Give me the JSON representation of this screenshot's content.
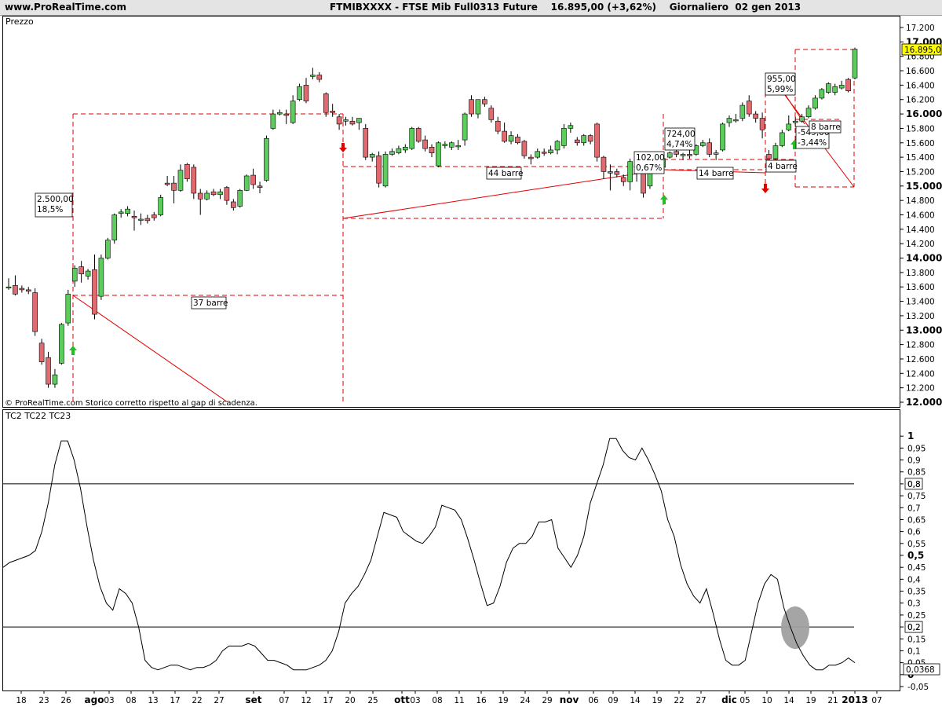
{
  "header": {
    "site": "www.ProRealTime.com",
    "title": "FTMIBXXXX - FTSE Mib Full0313 Future    16.895,00 (+3,62%)    Giornaliero  02 gen 2013"
  },
  "chart_data": [
    {
      "type": "candlestick",
      "title": "Prezzo",
      "footnote": "© ProRealTime.com  Storico corretto rispetto al gap di scadenza.",
      "ylim": [
        12000,
        17200
      ],
      "y_ticks": [
        "17.200",
        "17.000",
        "16.800",
        "16.600",
        "16.400",
        "16.200",
        "16.000",
        "15.800",
        "15.600",
        "15.400",
        "15.200",
        "15.000",
        "14.800",
        "14.600",
        "14.400",
        "14.200",
        "14.000",
        "13.800",
        "13.600",
        "13.400",
        "13.200",
        "13.000",
        "12.800",
        "12.600",
        "12.400",
        "12.200",
        "12.000"
      ],
      "last_price_label": "16.895,0",
      "last_price": 16895,
      "colors": {
        "up": "#5ccd5c",
        "down": "#e06a70",
        "annotation": "#e00000",
        "last_price_bg": "#ffff00"
      },
      "candles": [
        {
          "o": 13600,
          "h": 13720,
          "l": 13560,
          "c": 13600
        },
        {
          "o": 13620,
          "h": 13760,
          "l": 13480,
          "c": 13500
        },
        {
          "o": 13580,
          "h": 13620,
          "l": 13520,
          "c": 13560
        },
        {
          "o": 13560,
          "h": 13600,
          "l": 13500,
          "c": 13540
        },
        {
          "o": 13520,
          "h": 13580,
          "l": 12920,
          "c": 12980
        },
        {
          "o": 12820,
          "h": 12880,
          "l": 12520,
          "c": 12560
        },
        {
          "o": 12620,
          "h": 12700,
          "l": 12200,
          "c": 12250
        },
        {
          "o": 12250,
          "h": 12460,
          "l": 12200,
          "c": 12380
        },
        {
          "o": 12540,
          "h": 13100,
          "l": 12520,
          "c": 13080
        },
        {
          "o": 13100,
          "h": 13560,
          "l": 13060,
          "c": 13500
        },
        {
          "o": 13680,
          "h": 13900,
          "l": 13600,
          "c": 13860
        },
        {
          "o": 13880,
          "h": 13960,
          "l": 13660,
          "c": 13780
        },
        {
          "o": 13750,
          "h": 13850,
          "l": 13700,
          "c": 13820
        },
        {
          "o": 13840,
          "h": 14050,
          "l": 13150,
          "c": 13220
        },
        {
          "o": 13470,
          "h": 14050,
          "l": 13420,
          "c": 14000
        },
        {
          "o": 14000,
          "h": 14280,
          "l": 13980,
          "c": 14250
        },
        {
          "o": 14250,
          "h": 14620,
          "l": 14200,
          "c": 14600
        },
        {
          "o": 14620,
          "h": 14680,
          "l": 14560,
          "c": 14640
        },
        {
          "o": 14620,
          "h": 14720,
          "l": 14580,
          "c": 14680
        },
        {
          "o": 14580,
          "h": 14660,
          "l": 14380,
          "c": 14560
        },
        {
          "o": 14540,
          "h": 14620,
          "l": 14460,
          "c": 14540
        },
        {
          "o": 14550,
          "h": 14600,
          "l": 14480,
          "c": 14520
        },
        {
          "o": 14600,
          "h": 14640,
          "l": 14520,
          "c": 14560
        },
        {
          "o": 14600,
          "h": 14880,
          "l": 14580,
          "c": 14840
        },
        {
          "o": 15040,
          "h": 15140,
          "l": 15000,
          "c": 15020
        },
        {
          "o": 15040,
          "h": 15140,
          "l": 14760,
          "c": 14940
        },
        {
          "o": 14940,
          "h": 15300,
          "l": 14920,
          "c": 15220
        },
        {
          "o": 15300,
          "h": 15320,
          "l": 15060,
          "c": 15100
        },
        {
          "o": 15260,
          "h": 15300,
          "l": 14820,
          "c": 14900
        },
        {
          "o": 14900,
          "h": 14960,
          "l": 14600,
          "c": 14820
        },
        {
          "o": 14820,
          "h": 14940,
          "l": 14800,
          "c": 14900
        },
        {
          "o": 14920,
          "h": 14960,
          "l": 14860,
          "c": 14880
        },
        {
          "o": 14880,
          "h": 14960,
          "l": 14820,
          "c": 14920
        },
        {
          "o": 14980,
          "h": 15000,
          "l": 14740,
          "c": 14800
        },
        {
          "o": 14780,
          "h": 14820,
          "l": 14660,
          "c": 14700
        },
        {
          "o": 14720,
          "h": 14960,
          "l": 14700,
          "c": 14940
        },
        {
          "o": 14940,
          "h": 15160,
          "l": 14930,
          "c": 15140
        },
        {
          "o": 15150,
          "h": 15240,
          "l": 14960,
          "c": 15020
        },
        {
          "o": 15000,
          "h": 15060,
          "l": 14900,
          "c": 14980
        },
        {
          "o": 15080,
          "h": 15700,
          "l": 15060,
          "c": 15660
        },
        {
          "o": 15800,
          "h": 16060,
          "l": 15780,
          "c": 16000
        },
        {
          "o": 16000,
          "h": 16060,
          "l": 15980,
          "c": 16020
        },
        {
          "o": 16000,
          "h": 16060,
          "l": 15860,
          "c": 15980
        },
        {
          "o": 15880,
          "h": 16260,
          "l": 15860,
          "c": 16180
        },
        {
          "o": 16200,
          "h": 16420,
          "l": 16180,
          "c": 16380
        },
        {
          "o": 16400,
          "h": 16500,
          "l": 16150,
          "c": 16180
        },
        {
          "o": 16520,
          "h": 16640,
          "l": 16480,
          "c": 16540
        },
        {
          "o": 16540,
          "h": 16580,
          "l": 16440,
          "c": 16480
        },
        {
          "o": 16280,
          "h": 16300,
          "l": 15960,
          "c": 16020
        },
        {
          "o": 16040,
          "h": 16140,
          "l": 15960,
          "c": 16020
        },
        {
          "o": 15960,
          "h": 16000,
          "l": 15780,
          "c": 15860
        },
        {
          "o": 15900,
          "h": 15960,
          "l": 15840,
          "c": 15920
        },
        {
          "o": 15900,
          "h": 15960,
          "l": 15840,
          "c": 15860
        },
        {
          "o": 15880,
          "h": 15940,
          "l": 15780,
          "c": 15940
        },
        {
          "o": 15800,
          "h": 15860,
          "l": 15360,
          "c": 15400
        },
        {
          "o": 15400,
          "h": 15460,
          "l": 15340,
          "c": 15440
        },
        {
          "o": 15420,
          "h": 15480,
          "l": 14980,
          "c": 15040
        },
        {
          "o": 15000,
          "h": 15480,
          "l": 14980,
          "c": 15440
        },
        {
          "o": 15440,
          "h": 15520,
          "l": 15420,
          "c": 15480
        },
        {
          "o": 15460,
          "h": 15560,
          "l": 15440,
          "c": 15520
        },
        {
          "o": 15500,
          "h": 15580,
          "l": 15460,
          "c": 15540
        },
        {
          "o": 15520,
          "h": 15820,
          "l": 15500,
          "c": 15800
        },
        {
          "o": 15800,
          "h": 15820,
          "l": 15600,
          "c": 15620
        },
        {
          "o": 15640,
          "h": 15700,
          "l": 15480,
          "c": 15520
        },
        {
          "o": 15540,
          "h": 15580,
          "l": 15400,
          "c": 15460
        },
        {
          "o": 15280,
          "h": 15620,
          "l": 15260,
          "c": 15600
        },
        {
          "o": 15560,
          "h": 15620,
          "l": 15520,
          "c": 15580
        },
        {
          "o": 15540,
          "h": 15620,
          "l": 15500,
          "c": 15600
        },
        {
          "o": 15560,
          "h": 15640,
          "l": 15500,
          "c": 15560
        },
        {
          "o": 15640,
          "h": 16020,
          "l": 15560,
          "c": 16000
        },
        {
          "o": 16200,
          "h": 16260,
          "l": 15960,
          "c": 16000
        },
        {
          "o": 16000,
          "h": 16160,
          "l": 15940,
          "c": 16200
        },
        {
          "o": 16200,
          "h": 16240,
          "l": 16100,
          "c": 16140
        },
        {
          "o": 16080,
          "h": 16120,
          "l": 15880,
          "c": 15920
        },
        {
          "o": 15900,
          "h": 15960,
          "l": 15720,
          "c": 15760
        },
        {
          "o": 15760,
          "h": 15880,
          "l": 15600,
          "c": 15620
        },
        {
          "o": 15620,
          "h": 15760,
          "l": 15580,
          "c": 15700
        },
        {
          "o": 15680,
          "h": 15720,
          "l": 15580,
          "c": 15600
        },
        {
          "o": 15620,
          "h": 15640,
          "l": 15380,
          "c": 15420
        },
        {
          "o": 15400,
          "h": 15440,
          "l": 15300,
          "c": 15380
        },
        {
          "o": 15400,
          "h": 15520,
          "l": 15380,
          "c": 15480
        },
        {
          "o": 15470,
          "h": 15520,
          "l": 15420,
          "c": 15460
        },
        {
          "o": 15460,
          "h": 15560,
          "l": 15440,
          "c": 15500
        },
        {
          "o": 15500,
          "h": 15640,
          "l": 15440,
          "c": 15620
        },
        {
          "o": 15560,
          "h": 15860,
          "l": 15520,
          "c": 15800
        },
        {
          "o": 15800,
          "h": 15880,
          "l": 15740,
          "c": 15840
        },
        {
          "o": 15640,
          "h": 15680,
          "l": 15560,
          "c": 15600
        },
        {
          "o": 15600,
          "h": 15720,
          "l": 15560,
          "c": 15700
        },
        {
          "o": 15700,
          "h": 15720,
          "l": 15580,
          "c": 15620
        },
        {
          "o": 15860,
          "h": 15880,
          "l": 15340,
          "c": 15400
        },
        {
          "o": 15400,
          "h": 15420,
          "l": 15100,
          "c": 15200
        },
        {
          "o": 15200,
          "h": 15300,
          "l": 14940,
          "c": 15180
        },
        {
          "o": 15200,
          "h": 15240,
          "l": 15120,
          "c": 15160
        },
        {
          "o": 15120,
          "h": 15160,
          "l": 15000,
          "c": 15060
        },
        {
          "o": 15060,
          "h": 15380,
          "l": 14940,
          "c": 15340
        },
        {
          "o": 15200,
          "h": 15240,
          "l": 15060,
          "c": 15200
        },
        {
          "o": 15200,
          "h": 15240,
          "l": 14840,
          "c": 14900
        },
        {
          "o": 15000,
          "h": 15200,
          "l": 14960,
          "c": 15180
        },
        {
          "o": 15240,
          "h": 15320,
          "l": 15200,
          "c": 15260
        },
        {
          "o": 15260,
          "h": 15420,
          "l": 15240,
          "c": 15380
        },
        {
          "o": 15400,
          "h": 15480,
          "l": 15380,
          "c": 15460
        },
        {
          "o": 15480,
          "h": 15500,
          "l": 15400,
          "c": 15440
        },
        {
          "o": 15420,
          "h": 15460,
          "l": 15360,
          "c": 15440
        },
        {
          "o": 15440,
          "h": 15500,
          "l": 15380,
          "c": 15420
        },
        {
          "o": 15440,
          "h": 15580,
          "l": 15420,
          "c": 15560
        },
        {
          "o": 15560,
          "h": 15640,
          "l": 15540,
          "c": 15600
        },
        {
          "o": 15600,
          "h": 15660,
          "l": 15400,
          "c": 15440
        },
        {
          "o": 15440,
          "h": 15500,
          "l": 15360,
          "c": 15460
        },
        {
          "o": 15500,
          "h": 15880,
          "l": 15480,
          "c": 15860
        },
        {
          "o": 15880,
          "h": 15980,
          "l": 15820,
          "c": 15940
        },
        {
          "o": 15920,
          "h": 16000,
          "l": 15880,
          "c": 15920
        },
        {
          "o": 15940,
          "h": 16160,
          "l": 15900,
          "c": 16120
        },
        {
          "o": 16180,
          "h": 16260,
          "l": 15960,
          "c": 16000
        },
        {
          "o": 16000,
          "h": 16040,
          "l": 15880,
          "c": 15940
        },
        {
          "o": 15940,
          "h": 16020,
          "l": 15660,
          "c": 15780
        },
        {
          "o": 15440,
          "h": 15500,
          "l": 15380,
          "c": 15380
        },
        {
          "o": 15380,
          "h": 15600,
          "l": 15360,
          "c": 15560
        },
        {
          "o": 15560,
          "h": 15780,
          "l": 15540,
          "c": 15740
        },
        {
          "o": 15780,
          "h": 15980,
          "l": 15760,
          "c": 15860
        },
        {
          "o": 15880,
          "h": 15960,
          "l": 15820,
          "c": 15900
        },
        {
          "o": 15900,
          "h": 16000,
          "l": 15880,
          "c": 15960
        },
        {
          "o": 15960,
          "h": 16120,
          "l": 15940,
          "c": 16080
        },
        {
          "o": 16080,
          "h": 16260,
          "l": 16060,
          "c": 16220
        },
        {
          "o": 16220,
          "h": 16360,
          "l": 16200,
          "c": 16340
        },
        {
          "o": 16300,
          "h": 16440,
          "l": 16280,
          "c": 16420
        },
        {
          "o": 16300,
          "h": 16420,
          "l": 16260,
          "c": 16380
        },
        {
          "o": 16360,
          "h": 16460,
          "l": 16340,
          "c": 16400
        },
        {
          "o": 16480,
          "h": 16500,
          "l": 16300,
          "c": 16320
        },
        {
          "o": 16500,
          "h": 16920,
          "l": 16480,
          "c": 16900
        }
      ],
      "annotations": [
        {
          "type": "box",
          "label": "2.500,00\n18,5%"
        },
        {
          "type": "box",
          "label": "37 barre"
        },
        {
          "type": "box",
          "label": "44 barre"
        },
        {
          "type": "box",
          "label": "102,00\n0,67%"
        },
        {
          "type": "box",
          "label": "724,00\n4,74%"
        },
        {
          "type": "box",
          "label": "14 barre"
        },
        {
          "type": "box",
          "label": "955,00\n5,99%"
        },
        {
          "type": "box",
          "label": "-549,00\n-3,44%"
        },
        {
          "type": "box",
          "label": "8 barre"
        },
        {
          "type": "box",
          "label": "4 barre"
        }
      ]
    },
    {
      "type": "line",
      "title": "TC2 TC22 TC23",
      "ylim": [
        -0.05,
        1.05
      ],
      "y_ticks": [
        "1",
        "0,95",
        "0,9",
        "0,85",
        "0,8",
        "0,75",
        "0,7",
        "0,65",
        "0,6",
        "0,55",
        "0,5",
        "0,45",
        "0,4",
        "0,35",
        "0,3",
        "0,25",
        "0,2",
        "0,15",
        "0,1",
        "0,05",
        "0",
        "-0,05"
      ],
      "bold_ticks": [
        "1",
        "0,5",
        "0"
      ],
      "hlines": [
        0.8,
        0.2
      ],
      "hline_labels": [
        "0,8",
        "0,2"
      ],
      "last_value_label": "0,0368",
      "last_value": 0.0368,
      "x_labels": [
        "18",
        "23",
        "26",
        "ago",
        "03",
        "08",
        "13",
        "17",
        "22",
        "27",
        "set",
        "07",
        "12",
        "17",
        "20",
        "25",
        "ott",
        "03",
        "08",
        "11",
        "16",
        "19",
        "24",
        "29",
        "nov",
        "06",
        "09",
        "14",
        "19",
        "22",
        "27",
        "dic",
        "05",
        "10",
        "14",
        "19",
        "21",
        "2013",
        "07"
      ],
      "bold_x_labels": [
        "ago",
        "set",
        "ott",
        "nov",
        "dic",
        "2013"
      ],
      "series": [
        {
          "values": [
            0.45,
            0.47,
            0.48,
            0.49,
            0.5,
            0.52,
            0.6,
            0.72,
            0.88,
            0.98,
            0.98,
            0.9,
            0.78,
            0.62,
            0.48,
            0.37,
            0.3,
            0.27,
            0.36,
            0.34,
            0.3,
            0.2,
            0.06,
            0.03,
            0.02,
            0.03,
            0.04,
            0.04,
            0.03,
            0.02,
            0.03,
            0.03,
            0.04,
            0.06,
            0.1,
            0.12,
            0.12,
            0.12,
            0.13,
            0.12,
            0.09,
            0.06,
            0.06,
            0.05,
            0.04,
            0.02,
            0.02,
            0.02,
            0.03,
            0.04,
            0.06,
            0.1,
            0.18,
            0.3,
            0.34,
            0.37,
            0.42,
            0.48,
            0.58,
            0.68,
            0.67,
            0.66,
            0.6,
            0.58,
            0.56,
            0.55,
            0.58,
            0.62,
            0.71,
            0.7,
            0.69,
            0.65,
            0.57,
            0.48,
            0.38,
            0.29,
            0.3,
            0.37,
            0.47,
            0.53,
            0.55,
            0.55,
            0.58,
            0.64,
            0.64,
            0.65,
            0.53,
            0.49,
            0.45,
            0.5,
            0.58,
            0.72,
            0.8,
            0.88,
            0.99,
            0.99,
            0.94,
            0.91,
            0.9,
            0.95,
            0.9,
            0.84,
            0.77,
            0.65,
            0.58,
            0.46,
            0.38,
            0.33,
            0.3,
            0.36,
            0.26,
            0.15,
            0.06,
            0.04,
            0.04,
            0.06,
            0.18,
            0.3,
            0.38,
            0.42,
            0.4,
            0.28,
            0.2,
            0.13,
            0.08,
            0.04,
            0.02,
            0.02,
            0.04,
            0.04,
            0.05,
            0.07,
            0.05
          ]
        }
      ],
      "marker": {
        "type": "ellipse",
        "color": "#a0a0a0"
      }
    }
  ]
}
